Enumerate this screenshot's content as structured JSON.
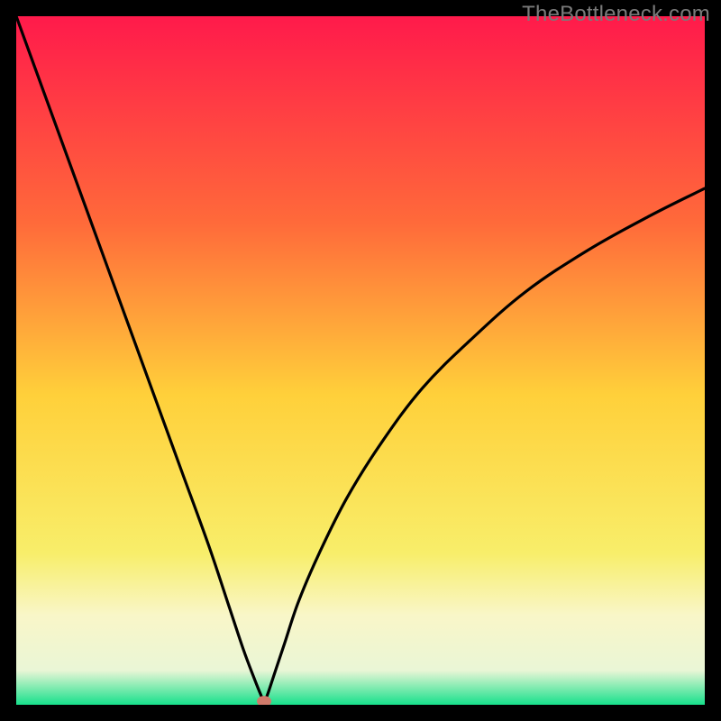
{
  "watermark": "TheBottleneck.com",
  "chart_data": {
    "type": "line",
    "title": "",
    "xlabel": "",
    "ylabel": "",
    "xlim": [
      0,
      100
    ],
    "ylim": [
      0,
      100
    ],
    "grid": false,
    "legend": false,
    "gradient_stops": [
      {
        "pct": 0,
        "color": "#ff1a4b"
      },
      {
        "pct": 30,
        "color": "#ff6a3a"
      },
      {
        "pct": 55,
        "color": "#ffd03a"
      },
      {
        "pct": 78,
        "color": "#f8ee6a"
      },
      {
        "pct": 87,
        "color": "#f9f6c8"
      },
      {
        "pct": 95,
        "color": "#eaf6d6"
      },
      {
        "pct": 100,
        "color": "#17e08b"
      }
    ],
    "series": [
      {
        "name": "bottleneck-curve",
        "description": "V-shaped curve; left slope near-linear, right side concave rising",
        "x": [
          0,
          4,
          8,
          12,
          16,
          20,
          24,
          28,
          31,
          33,
          34.5,
          35.5,
          36,
          36.5,
          37.5,
          39,
          41,
          44,
          48,
          53,
          59,
          66,
          74,
          83,
          92,
          100
        ],
        "y": [
          100,
          89,
          78,
          67,
          56,
          45,
          34,
          23,
          14,
          8,
          4,
          1.5,
          0.5,
          1.5,
          4.5,
          9,
          15,
          22,
          30,
          38,
          46,
          53,
          60,
          66,
          71,
          75
        ]
      }
    ],
    "marker": {
      "x": 36,
      "y": 0.5,
      "color": "#d07a6a",
      "rx": 8,
      "ry": 6
    }
  }
}
